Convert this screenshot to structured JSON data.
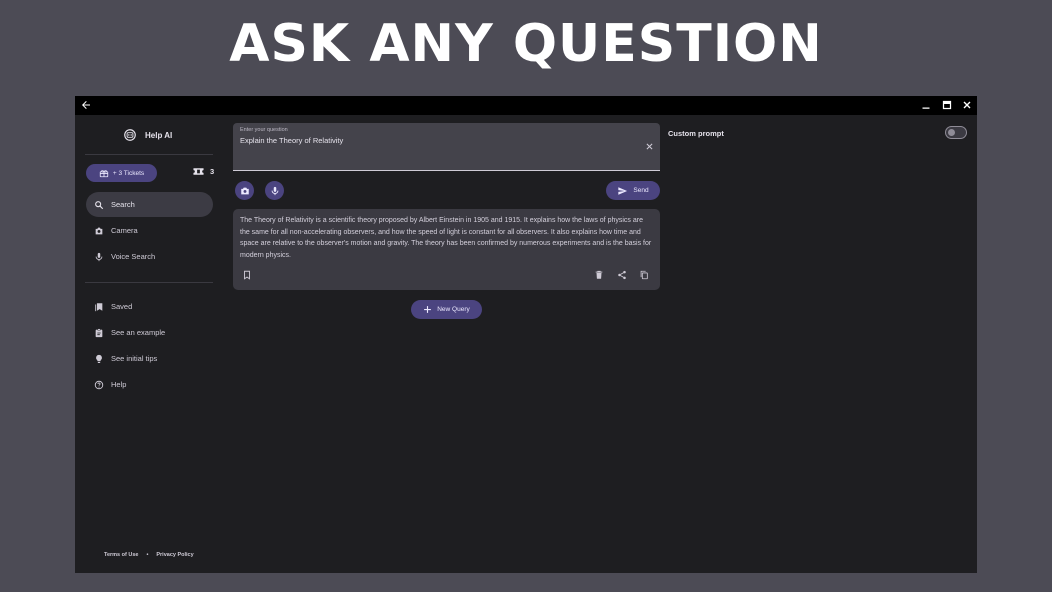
{
  "headline": "ASK ANY QUESTION",
  "app": {
    "title": "Help AI"
  },
  "sidebar": {
    "tickets_button": "+ 3 Tickets",
    "tickets_count": "3",
    "nav": [
      {
        "label": "Search",
        "icon": "search-icon",
        "active": true
      },
      {
        "label": "Camera",
        "icon": "camera-icon"
      },
      {
        "label": "Voice Search",
        "icon": "microphone-icon"
      }
    ],
    "nav2": [
      {
        "label": "Saved",
        "icon": "bookmarks-icon"
      },
      {
        "label": "See an example",
        "icon": "clipboard-icon"
      },
      {
        "label": "See initial tips",
        "icon": "lightbulb-icon"
      },
      {
        "label": "Help",
        "icon": "help-icon"
      }
    ],
    "footer": {
      "terms": "Terms of Use",
      "separator": "•",
      "privacy": "Privacy Policy"
    }
  },
  "main": {
    "question_label": "Enter your question",
    "question_value": "Explain the Theory of Relativity",
    "send_label": "Send",
    "answer": "The Theory of Relativity is a scientific theory proposed by Albert Einstein in 1905 and 1915. It explains how the laws of physics are the same for all non-accelerating observers, and how the speed of light is constant for all observers. It also explains how time and space are relative to the observer's motion and gravity. The theory has been confirmed by numerous experiments and is the basis for modern physics.",
    "new_query_label": "New Query",
    "custom_prompt_label": "Custom prompt",
    "custom_prompt_enabled": false
  },
  "colors": {
    "accent": "#4b4480",
    "window_bg": "#1e1e21",
    "page_bg": "#4c4b55"
  }
}
